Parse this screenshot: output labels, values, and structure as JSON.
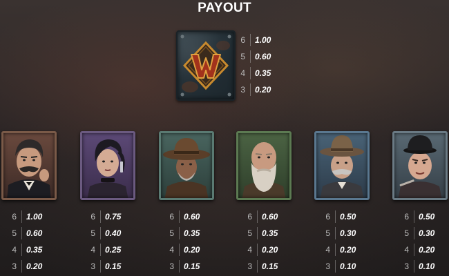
{
  "header": {
    "title": "PAYOUT"
  },
  "wild": {
    "icon": "wild-w-icon",
    "payouts": [
      {
        "count": "6",
        "value": "1.00"
      },
      {
        "count": "5",
        "value": "0.60"
      },
      {
        "count": "4",
        "value": "0.35"
      },
      {
        "count": "3",
        "value": "0.20"
      }
    ]
  },
  "symbols": [
    {
      "icon": "mustached-gentleman-icon",
      "payouts": [
        {
          "count": "6",
          "value": "1.00"
        },
        {
          "count": "5",
          "value": "0.60"
        },
        {
          "count": "4",
          "value": "0.35"
        },
        {
          "count": "3",
          "value": "0.20"
        }
      ]
    },
    {
      "icon": "dark-haired-woman-icon",
      "payouts": [
        {
          "count": "6",
          "value": "0.75"
        },
        {
          "count": "5",
          "value": "0.40"
        },
        {
          "count": "4",
          "value": "0.25"
        },
        {
          "count": "3",
          "value": "0.15"
        }
      ]
    },
    {
      "icon": "cowboy-hat-man-icon",
      "payouts": [
        {
          "count": "6",
          "value": "0.60"
        },
        {
          "count": "5",
          "value": "0.35"
        },
        {
          "count": "4",
          "value": "0.20"
        },
        {
          "count": "3",
          "value": "0.15"
        }
      ]
    },
    {
      "icon": "bearded-bald-man-icon",
      "payouts": [
        {
          "count": "6",
          "value": "0.60"
        },
        {
          "count": "5",
          "value": "0.35"
        },
        {
          "count": "4",
          "value": "0.20"
        },
        {
          "count": "3",
          "value": "0.15"
        }
      ]
    },
    {
      "icon": "old-cowboy-icon",
      "payouts": [
        {
          "count": "6",
          "value": "0.50"
        },
        {
          "count": "5",
          "value": "0.30"
        },
        {
          "count": "4",
          "value": "0.20"
        },
        {
          "count": "3",
          "value": "0.10"
        }
      ]
    },
    {
      "icon": "bowler-hat-boy-icon",
      "payouts": [
        {
          "count": "6",
          "value": "0.50"
        },
        {
          "count": "5",
          "value": "0.30"
        },
        {
          "count": "4",
          "value": "0.20"
        },
        {
          "count": "3",
          "value": "0.10"
        }
      ]
    }
  ]
}
